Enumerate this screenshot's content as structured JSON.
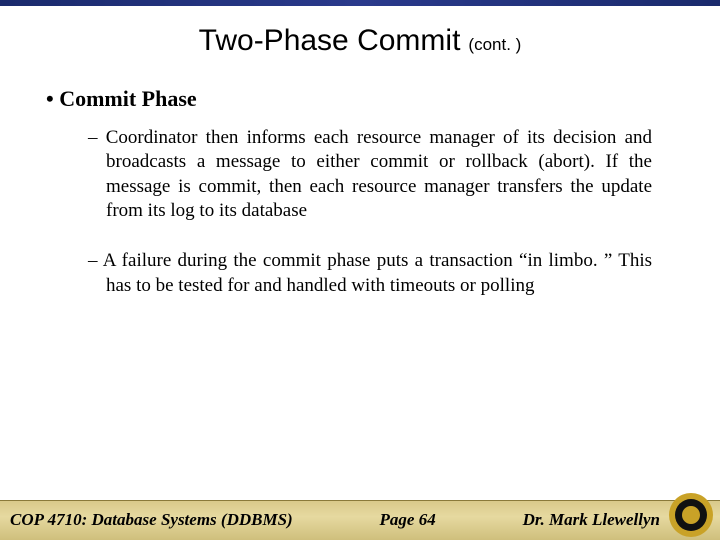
{
  "title": {
    "main": "Two-Phase Commit",
    "cont": "(cont. )"
  },
  "bullets": {
    "level1": "Commit Phase",
    "level2": [
      "Coordinator then informs each resource manager of its decision and broadcasts a message to either commit or rollback (abort).   If the message is commit, then each resource manager transfers the update from its log to its database",
      "A failure during the commit phase puts a transaction “in limbo. ” This has to be tested for and handled with timeouts or polling"
    ]
  },
  "footer": {
    "left": "COP 4710: Database Systems  (DDBMS)",
    "mid": "Page 64",
    "right": "Dr. Mark Llewellyn"
  }
}
